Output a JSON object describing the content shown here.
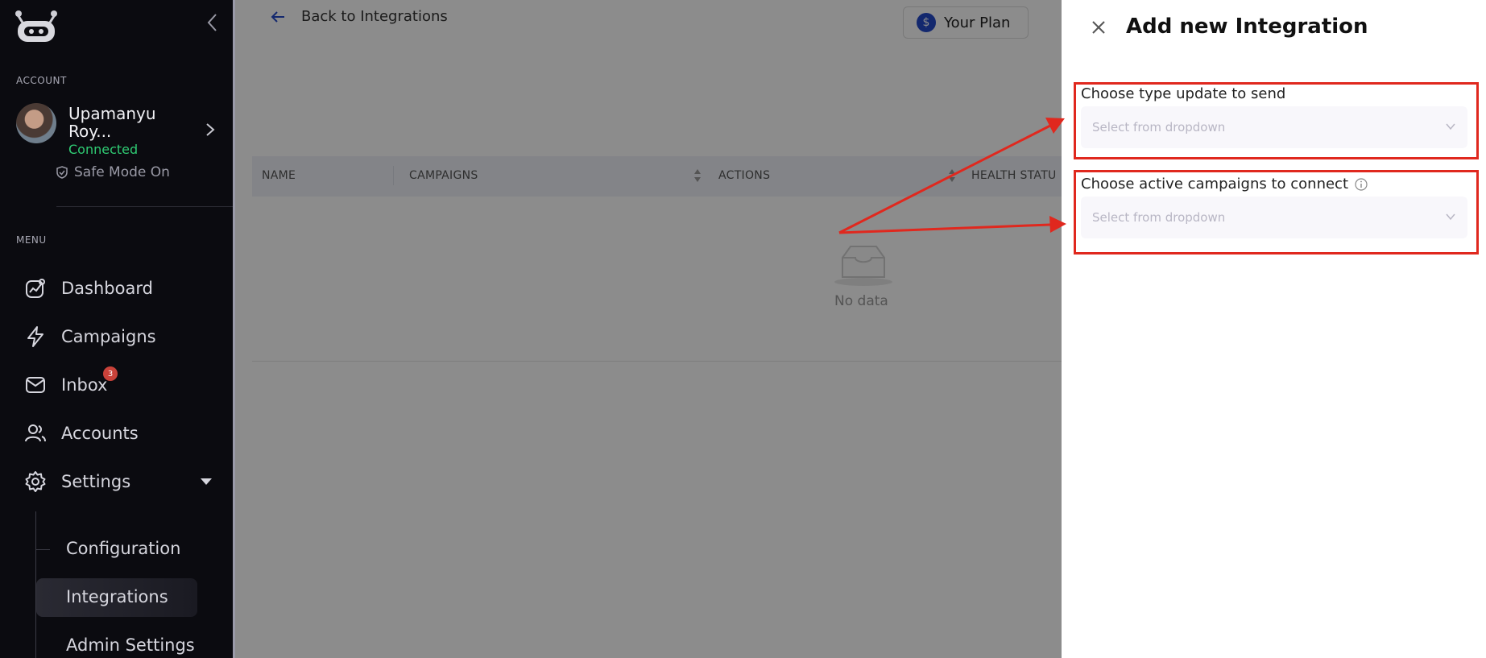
{
  "sidebar": {
    "account_section": "ACCOUNT",
    "account": {
      "name": "Upamanyu Roy...",
      "status": "Connected"
    },
    "safe_mode": "Safe Mode On",
    "menu_section": "MENU",
    "items": [
      {
        "label": "Dashboard"
      },
      {
        "label": "Campaigns"
      },
      {
        "label": "Inbox",
        "badge": "3"
      },
      {
        "label": "Accounts"
      },
      {
        "label": "Settings"
      }
    ],
    "settings_sub": [
      {
        "label": "Configuration"
      },
      {
        "label": "Integrations"
      },
      {
        "label": "Admin Settings"
      }
    ]
  },
  "main": {
    "back_label": "Back to Integrations",
    "plan_label": "Your Plan",
    "table": {
      "columns": [
        "NAME",
        "CAMPAIGNS",
        "ACTIONS",
        "HEALTH STATU"
      ],
      "empty_text": "No data"
    }
  },
  "drawer": {
    "title": "Add new Integration",
    "fields": [
      {
        "label": "Choose type update to send",
        "placeholder": "Select from dropdown"
      },
      {
        "label": "Choose active campaigns to connect",
        "placeholder": "Select from dropdown"
      }
    ]
  },
  "colors": {
    "sidebar_bg": "#0b0b10",
    "connected": "#2fcb73",
    "badge": "#c9423a",
    "annotation": "#e0281e",
    "accent": "#2449c9"
  }
}
